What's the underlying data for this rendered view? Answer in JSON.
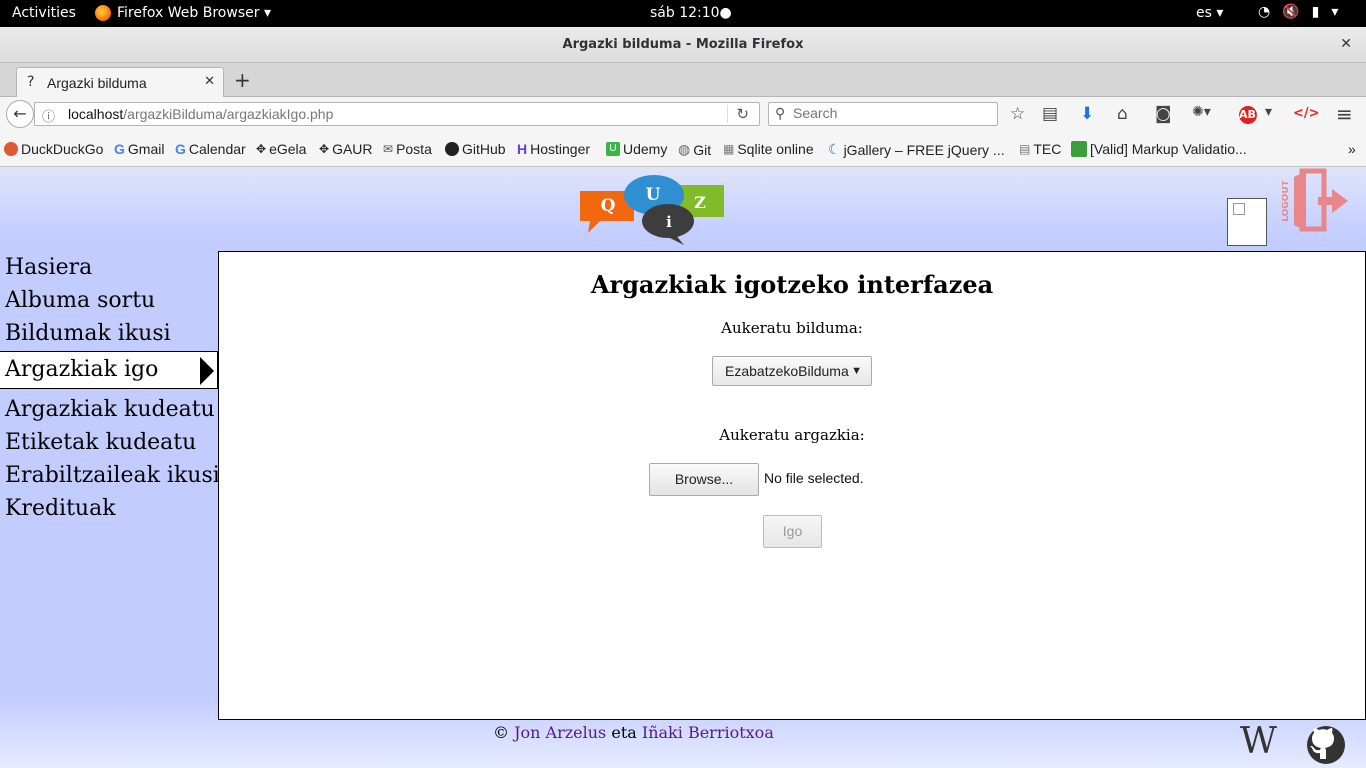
{
  "system": {
    "activities": "Activities",
    "app_menu": "Firefox Web Browser ▾",
    "clock": "sáb 12:10●",
    "lang": "es ▾"
  },
  "window": {
    "title": "Argazki bilduma - Mozilla Firefox",
    "close": "✕"
  },
  "tab": {
    "label": "Argazki bilduma",
    "close": "✕",
    "new": "+"
  },
  "nav": {
    "url_host": "localhost",
    "url_path": "/argazkiBilduma/argazkiakIgo.php",
    "search_placeholder": "Search"
  },
  "bookmarks": [
    "DuckDuckGo",
    "Gmail",
    "Calendar",
    "eGela",
    "GAUR",
    "Posta",
    "GitHub",
    "Hostinger",
    "Udemy",
    "Git",
    "Sqlite online",
    "jGallery – FREE jQuery ...",
    "TEC",
    "[Valid] Markup Validatio..."
  ],
  "bookmarks_more": "»",
  "logo": {
    "letters": [
      "Q",
      "U",
      "i",
      "Z"
    ]
  },
  "logout_text": "LOGOUT",
  "sidebar": {
    "items": [
      "Hasiera",
      "Albuma sortu",
      "Bildumak ikusi",
      "Argazkiak igo",
      "Argazkiak kudeatu",
      "Etiketak kudeatu",
      "Erabiltzaileak ikusi",
      "Kredituak"
    ],
    "active_index": 3
  },
  "main": {
    "heading": "Argazkiak igotzeko interfazea",
    "album_label": "Aukeratu bilduma:",
    "album_value": "EzabatzekoBilduma",
    "photo_label": "Aukeratu argazkia:",
    "browse_label": "Browse...",
    "file_status": "No file selected.",
    "submit_label": "Igo"
  },
  "footer": {
    "copyright": "©",
    "author1": "Jon Arzelus",
    "and": "eta",
    "author2": "Iñaki Berriotxoa",
    "wiki_glyph": "W"
  }
}
